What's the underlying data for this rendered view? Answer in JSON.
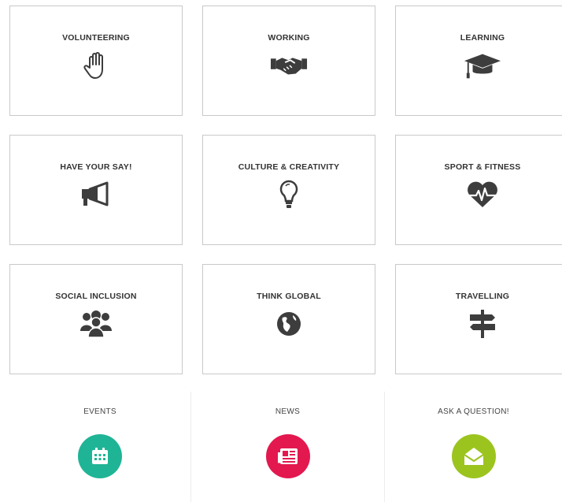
{
  "tiles": [
    {
      "label": "VOLUNTEERING",
      "icon": "hand-icon"
    },
    {
      "label": "WORKING",
      "icon": "handshake-icon"
    },
    {
      "label": "LEARNING",
      "icon": "graduation-cap-icon"
    },
    {
      "label": "HAVE YOUR SAY!",
      "icon": "megaphone-icon"
    },
    {
      "label": "CULTURE & CREATIVITY",
      "icon": "lightbulb-icon"
    },
    {
      "label": "SPORT & FITNESS",
      "icon": "heartbeat-icon"
    },
    {
      "label": "SOCIAL INCLUSION",
      "icon": "group-icon"
    },
    {
      "label": "THINK GLOBAL",
      "icon": "globe-icon"
    },
    {
      "label": "TRAVELLING",
      "icon": "signpost-icon"
    }
  ],
  "bottom": [
    {
      "label": "EVENTS",
      "icon": "calendar-icon",
      "color": "#1fb495"
    },
    {
      "label": "NEWS",
      "icon": "newspaper-icon",
      "color": "#e3184f"
    },
    {
      "label": "ASK A QUESTION!",
      "icon": "envelope-icon",
      "color": "#9cc41f"
    }
  ],
  "colors": {
    "icon": "#3d3d3d",
    "border": "#c9c9c9"
  }
}
